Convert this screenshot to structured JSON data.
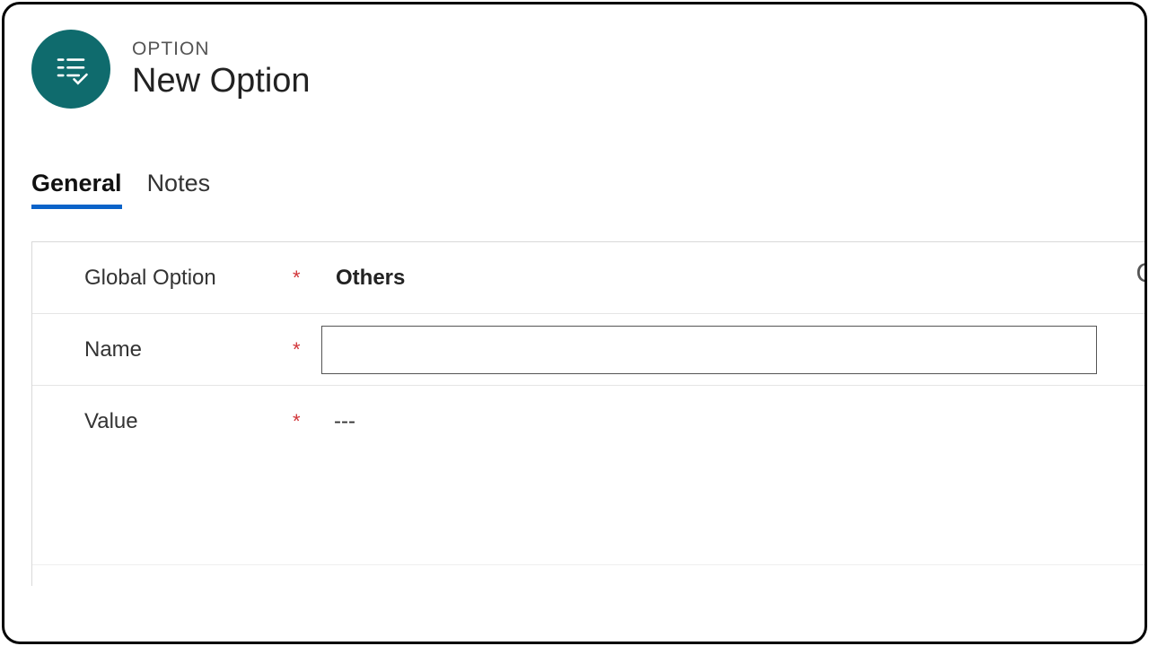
{
  "header": {
    "eyebrow": "OPTION",
    "title": "New Option",
    "icon_name": "option-list-icon",
    "icon_bg": "#0f6b6d"
  },
  "tabs": [
    {
      "id": "general",
      "label": "General",
      "active": true
    },
    {
      "id": "notes",
      "label": "Notes",
      "active": false
    }
  ],
  "form": {
    "global_option": {
      "label": "Global Option",
      "required": "*",
      "value": "Others"
    },
    "name": {
      "label": "Name",
      "required": "*",
      "value": ""
    },
    "value": {
      "label": "Value",
      "required": "*",
      "display": "---"
    }
  }
}
